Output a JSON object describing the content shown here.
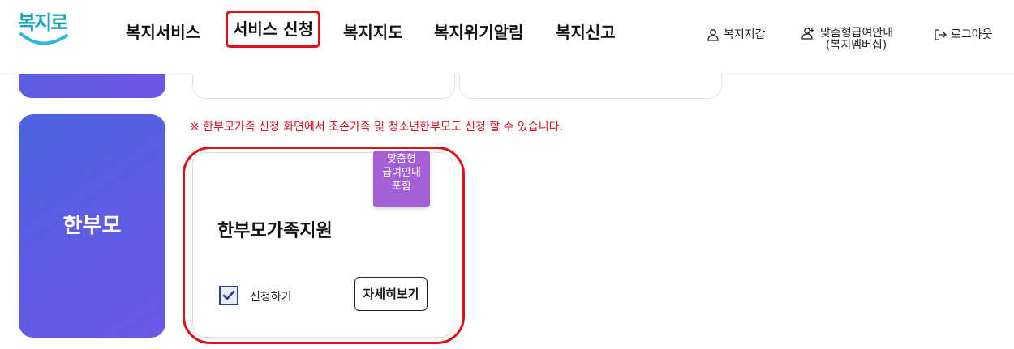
{
  "header": {
    "logo_text": "복지로",
    "nav": [
      {
        "label": "복지서비스"
      },
      {
        "label": "서비스 신청"
      },
      {
        "label": "복지지도"
      },
      {
        "label": "복지위기알림"
      },
      {
        "label": "복지신고"
      }
    ],
    "utils": [
      {
        "label": "복지지갑",
        "icon": "user-icon"
      },
      {
        "label_line1": "맞춤형급여안내",
        "label_line2": "(복지멤버십)",
        "icon": "user-plus-icon"
      },
      {
        "label": "로그아웃",
        "icon": "logout-icon"
      }
    ]
  },
  "side_category": {
    "label": "한부모"
  },
  "notice": "※ 한부모가족 신청 화면에서 조손가족 및 청소년한부모도 신청 할 수 있습니다.",
  "card": {
    "badge_lines": [
      "맞춤형",
      "급여안내",
      "포함"
    ],
    "title": "한부모가족지원",
    "checkbox_label": "신청하기",
    "checkbox_checked": true,
    "detail_button": "자세히보기"
  },
  "colors": {
    "accent_red": "#e0101a",
    "side_gradient_start": "#4e63e0",
    "side_gradient_end": "#6d58e8",
    "badge_purple": "#a25fd6",
    "notice_red": "#d3141c"
  }
}
